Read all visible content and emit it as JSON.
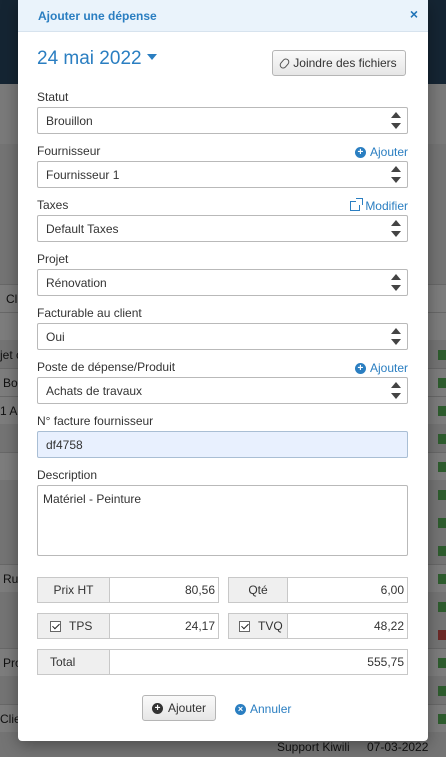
{
  "background": {
    "row_texts": [
      "Cli",
      "jet c",
      "Bo",
      "1 A",
      "Ru",
      "Pro",
      "Clie"
    ],
    "footer_name": "Support Kiwili",
    "footer_date": "07-03-2022"
  },
  "modal": {
    "title": "Ajouter une dépense",
    "close_icon": "×",
    "date": "24 mai 2022",
    "attach_label": "Joindre des fichiers",
    "fields": {
      "statut": {
        "label": "Statut",
        "value": "Brouillon"
      },
      "fournisseur": {
        "label": "Fournisseur",
        "value": "Fournisseur 1",
        "action": "Ajouter"
      },
      "taxes": {
        "label": "Taxes",
        "value": "Default Taxes",
        "action": "Modifier"
      },
      "projet": {
        "label": "Projet",
        "value": "Rénovation"
      },
      "facturable": {
        "label": "Facturable au client",
        "value": "Oui"
      },
      "poste": {
        "label": "Poste de dépense/Produit",
        "value": "Achats de travaux",
        "action": "Ajouter"
      },
      "facture": {
        "label": "N° facture fournisseur",
        "value": "df4758"
      },
      "description": {
        "label": "Description",
        "value": "Matériel - Peinture"
      }
    },
    "totals": {
      "prix_ht_label": "Prix HT",
      "prix_ht": "80,56",
      "qte_label": "Qté",
      "qte": "6,00",
      "tps_label": "TPS",
      "tps": "24,17",
      "tvq_label": "TVQ",
      "tvq": "48,22",
      "total_label": "Total",
      "total": "555,75"
    },
    "buttons": {
      "add": "Ajouter",
      "cancel": "Annuler"
    }
  },
  "colors": {
    "accent": "#2a7ec1",
    "input_autofill": "#e8f0fe"
  }
}
